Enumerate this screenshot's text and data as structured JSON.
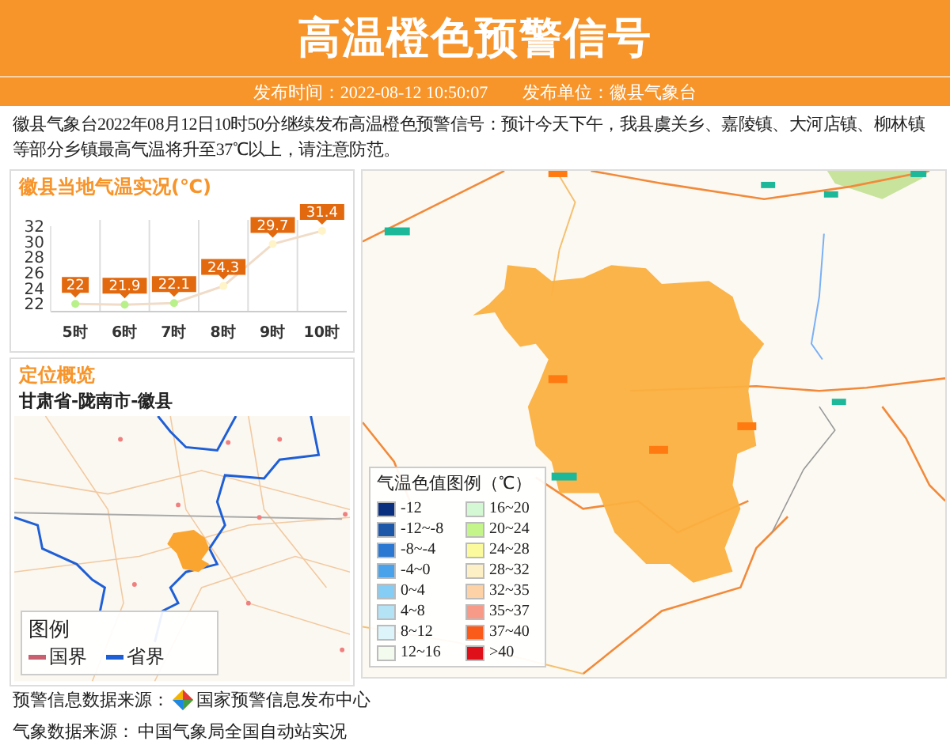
{
  "header": {
    "title": "高温橙色预警信号",
    "publish_time": "发布时间：2022-08-12 10:50:07",
    "publisher": "发布单位：徽县气象台"
  },
  "description": "徽县气象台2022年08月12日10时50分继续发布高温橙色预警信号：预计今天下午，我县虞关乡、嘉陵镇、大河店镇、柳林镇等部分乡镇最高气温将升至37℃以上，请注意防范。",
  "temperature_panel": {
    "title": "徽县当地气温实况(℃)",
    "chart_data": {
      "type": "line",
      "categories": [
        "5时",
        "6时",
        "7时",
        "8时",
        "9时",
        "10时"
      ],
      "values": [
        22,
        21.9,
        22.1,
        24.3,
        29.7,
        31.4
      ],
      "marker": true,
      "ylim": [
        21,
        32
      ],
      "yticks": [
        22,
        24,
        26,
        28,
        30,
        32
      ],
      "data_labels": true
    }
  },
  "location_panel": {
    "title": "定位概览",
    "region": "甘肃省-陇南市-徽县",
    "legend": {
      "title": "图例",
      "items": [
        {
          "label": "国界",
          "color": "#c96070"
        },
        {
          "label": "省界",
          "color": "#1f5fd6"
        }
      ]
    }
  },
  "map_legend": {
    "title": "气温色值图例（℃）",
    "items": [
      {
        "label": "-12",
        "color": "#0b2f7f"
      },
      {
        "label": "-12~-8",
        "color": "#1d58a8"
      },
      {
        "label": "-8~-4",
        "color": "#2a78d2"
      },
      {
        "label": "-4~0",
        "color": "#4aa2ea"
      },
      {
        "label": "0~4",
        "color": "#86cdf5"
      },
      {
        "label": "4~8",
        "color": "#b4e3f6"
      },
      {
        "label": "8~12",
        "color": "#dcf4fa"
      },
      {
        "label": "12~16",
        "color": "#f2fbee"
      },
      {
        "label": "16~20",
        "color": "#d4f7d4"
      },
      {
        "label": "20~24",
        "color": "#c3f58a"
      },
      {
        "label": "24~28",
        "color": "#fbfb9e"
      },
      {
        "label": "28~32",
        "color": "#fdf0c6"
      },
      {
        "label": "32~35",
        "color": "#fdd2a6"
      },
      {
        "label": "35~37",
        "color": "#f89a88"
      },
      {
        "label": "37~40",
        "color": "#fa5a1a"
      },
      {
        "label": ">40",
        "color": "#e0101a"
      }
    ]
  },
  "footer": [
    {
      "label": "预警信息数据来源：",
      "value": "国家预警信息发布中心",
      "logo": true
    },
    {
      "label": "气象数据来源：",
      "value": "中国气象局全国自动站实况",
      "logo": false
    }
  ]
}
